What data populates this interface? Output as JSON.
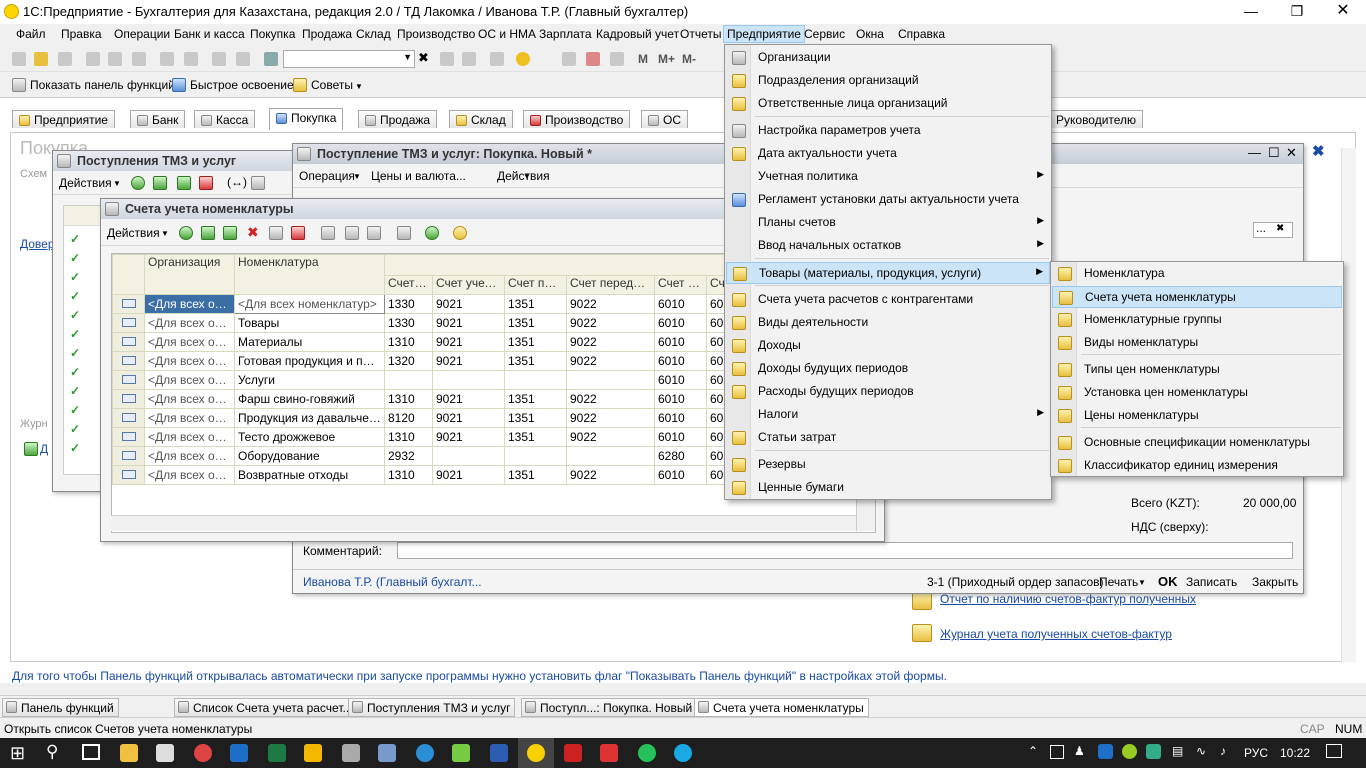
{
  "app": {
    "title": "1С:Предприятие - Бухгалтерия для Казахстана, редакция 2.0 / ТД Лакомка / Иванова Т.Р. (Главный бухгалтер)"
  },
  "menubar": [
    "Файл",
    "Правка",
    "Операции",
    "Банк и касса",
    "Покупка",
    "Продажа",
    "Склад",
    "Производство",
    "ОС и НМА",
    "Зарплата",
    "Кадровый учет",
    "Отчеты",
    "Предприятие",
    "Сервис",
    "Окна",
    "Справка"
  ],
  "toolbar2": {
    "show_panel": "Показать панель функций",
    "quick": "Быстрое освоение",
    "tips": "Советы"
  },
  "tabs": [
    "Предприятие",
    "Банк",
    "Касса",
    "Покупка",
    "Продажа",
    "Склад",
    "Производство",
    "ОС",
    "Руководителю"
  ],
  "panel": {
    "heading": "Покупка",
    "schem": "Схем",
    "dover": "Довер",
    "zhurn": "Журн",
    "d": "Д"
  },
  "win_list": {
    "title": "Поступления ТМЗ и услуг",
    "actions": "Действия"
  },
  "win_doc": {
    "title": "Поступление ТМЗ и услуг: Покупка. Новый *",
    "op": "Операция",
    "prices": "Цены и валюта...",
    "actions": "Действия",
    "total_label": "Всего (KZT):",
    "total_value": "20 000,00",
    "vat_label": "НДС (сверху):",
    "comment_label": "Комментарий:",
    "user": "Иванова Т.Р. (Главный бухгалт...",
    "order": "3-1 (Приходный ордер запасов)",
    "print": "Печать",
    "ok": "OK",
    "save": "Записать",
    "close": "Закрыть"
  },
  "win_accounts": {
    "title": "Счета учета номенклатуры",
    "actions": "Действия",
    "columns": [
      "Организация",
      "Номенклатура",
      "Счет у...",
      "Счет учета...",
      "Счет пер...",
      "Счет передач...",
      "Счет д...",
      "Сч"
    ],
    "rows": [
      [
        "<Для всех ор...",
        "<Для всех номенклатур>",
        "1330",
        "9021",
        "1351",
        "9022",
        "6010",
        "60"
      ],
      [
        "<Для всех ор...",
        "Товары",
        "1330",
        "9021",
        "1351",
        "9022",
        "6010",
        "60"
      ],
      [
        "<Для всех ор...",
        "Материалы",
        "1310",
        "9021",
        "1351",
        "9022",
        "6010",
        "60"
      ],
      [
        "<Для всех ор...",
        "Готовая продукция и полу...",
        "1320",
        "9021",
        "1351",
        "9022",
        "6010",
        "60"
      ],
      [
        "<Для всех ор...",
        "Услуги",
        "",
        "",
        "",
        "",
        "6010",
        "60"
      ],
      [
        "<Для всех ор...",
        "Фарш свино-говяжий",
        "1310",
        "9021",
        "1351",
        "9022",
        "6010",
        "60"
      ],
      [
        "<Для всех ор...",
        "Продукция из давальческ...",
        "8120",
        "9021",
        "1351",
        "9022",
        "6010",
        "60"
      ],
      [
        "<Для всех ор...",
        "Тесто дрожжевое",
        "1310",
        "9021",
        "1351",
        "9022",
        "6010",
        "60"
      ],
      [
        "<Для всех ор...",
        "Оборудование",
        "2932",
        "",
        "",
        "",
        "6280",
        "60"
      ],
      [
        "<Для всех ор...",
        "Возвратные отходы",
        "1310",
        "9021",
        "1351",
        "9022",
        "6010",
        "60"
      ]
    ]
  },
  "menu_main": [
    "Организации",
    "Подразделения организаций",
    "Ответственные лица организаций",
    "Настройка параметров учета",
    "Дата актуальности учета",
    "Учетная политика",
    "Регламент установки даты актуальности учета",
    "Планы счетов",
    "Ввод начальных остатков",
    "Товары (материалы, продукция, услуги)",
    "Счета учета расчетов с контрагентами",
    "Виды деятельности",
    "Доходы",
    "Доходы будущих периодов",
    "Расходы будущих периодов",
    "Налоги",
    "Статьи затрат",
    "Резервы",
    "Ценные бумаги"
  ],
  "menu_sub": [
    "Номенклатура",
    "Счета учета номенклатуры",
    "Номенклатурные группы",
    "Виды номенклатуры",
    "Типы цен номенклатуры",
    "Установка цен номенклатуры",
    "Цены номенклатуры",
    "Основные спецификации номенклатуры",
    "Классификатор единиц измерения"
  ],
  "links": [
    "Отчет по наличию счетов-фактур полученных",
    "Журнал учета полученных счетов-фактур"
  ],
  "hint": "Для того чтобы Панель функций открывалась автоматически при запуске программы нужно установить флаг \"Показывать Панель функций\" в настройках этой формы.",
  "tasks": [
    "Панель функций",
    "Список Счета учета расчет...",
    "Поступления ТМЗ и услуг",
    "Поступл...: Покупка. Новый *",
    "Счета учета номенклатуры"
  ],
  "status": {
    "text": "Открыть список Счетов учета номенклатуры",
    "cap": "CAP",
    "num": "NUM"
  },
  "wintask": {
    "lang": "РУС",
    "time": "10:22"
  }
}
